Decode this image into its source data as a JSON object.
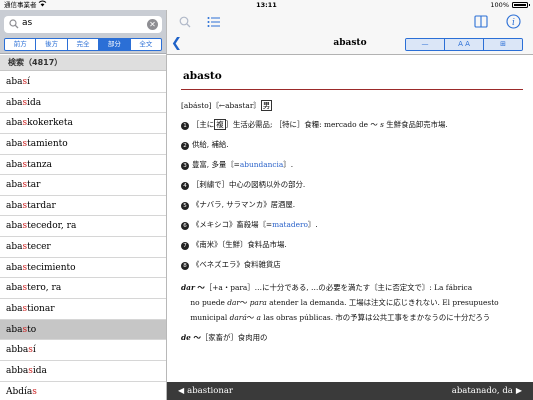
{
  "status": {
    "carrier": "通信事業者",
    "time": "13:11",
    "battery": "100%"
  },
  "search": {
    "value": "as",
    "clear_icon": "clear-icon"
  },
  "modes": [
    "前方",
    "後方",
    "完全",
    "部分",
    "全文"
  ],
  "active_mode": "部分",
  "results_header": "検索（4817）",
  "results": [
    {
      "pre": "aba",
      "hl": "s",
      "post": "í"
    },
    {
      "pre": "aba",
      "hl": "s",
      "post": "ida"
    },
    {
      "pre": "aba",
      "hl": "s",
      "post": "kokerketa"
    },
    {
      "pre": "aba",
      "hl": "s",
      "post": "tamiento"
    },
    {
      "pre": "aba",
      "hl": "s",
      "post": "tanza"
    },
    {
      "pre": "aba",
      "hl": "s",
      "post": "tar"
    },
    {
      "pre": "aba",
      "hl": "s",
      "post": "tardar"
    },
    {
      "pre": "aba",
      "hl": "s",
      "post": "tecedor, ra"
    },
    {
      "pre": "aba",
      "hl": "s",
      "post": "tecer"
    },
    {
      "pre": "aba",
      "hl": "s",
      "post": "tecimiento"
    },
    {
      "pre": "aba",
      "hl": "s",
      "post": "tero, ra"
    },
    {
      "pre": "aba",
      "hl": "s",
      "post": "tionar"
    },
    {
      "pre": "aba",
      "hl": "s",
      "post": "to"
    },
    {
      "pre": "abba",
      "hl": "s",
      "post": "í"
    },
    {
      "pre": "abba",
      "hl": "s",
      "post": "ida"
    },
    {
      "pre": "Abdía",
      "hl": "s",
      "post": ""
    }
  ],
  "selected_index": 12,
  "nav": {
    "title": "abasto",
    "seg": [
      "—",
      "A A",
      "⊞"
    ]
  },
  "entry": {
    "headword": "abasto",
    "lines": [
      {
        "html": "[abásto]〘←abastar〙<span style=\"border:1px solid #333;padding:0 1px;\">男</span>"
      },
      {
        "html": "<span class=\"num\">1</span>［主に<span style=\"border:1px solid #333;padding:0 1px;\">複</span>］生活必需品; ［特に］食糧: mercado de 〜 <i>s</i> 生鮮食品卸売市場."
      },
      {
        "html": "<span class=\"num\">2</span>供給, 補給."
      },
      {
        "html": "<span class=\"num\">3</span>豊富, 多量〘=<span class=\"ref\">abundancia</span>〙."
      },
      {
        "html": "<span class=\"num\">4</span>［刺繍で］中心の図柄以外の部分."
      },
      {
        "html": "<span class=\"num\">5</span>《ナバラ, サラマンカ》居酒屋."
      },
      {
        "html": "<span class=\"num\">6</span>《メキシコ》畜殺場〘=<span class=\"ref\">matadero</span>〙."
      },
      {
        "html": "<span class=\"num\">7</span>《南米》〔生鮮〕食料品市場."
      },
      {
        "html": "<span class=\"num\">8</span>《ベネズエラ》食料雑貨店"
      },
      {
        "html": "<b><i>dar</i> 〜</b>［+a・para］…に十分である, …の必要を満たす〘主に否定文で〙: La fábrica"
      },
      {
        "html": "&nbsp;&nbsp;&nbsp;&nbsp;no puede <i>dar</i>〜 <i>para</i> atender la demanda. 工場は注文に応じきれない. El presupuesto"
      },
      {
        "html": "&nbsp;&nbsp;&nbsp;&nbsp;municipal <i>dará</i>〜 <i>a</i> las obras públicas. 市の予算は公共工事をまかなうのに十分だろう"
      },
      {
        "html": "<b><i>de</i> 〜</b>［家畜が］食肉用の"
      }
    ]
  },
  "bottom": {
    "prev": "abastionar",
    "next": "abatanado, da"
  },
  "colors": {
    "accent": "#2b6fd6",
    "highlight": "#cc2222",
    "rule": "#9b2a2a",
    "bottombar": "#3a3a3a"
  }
}
